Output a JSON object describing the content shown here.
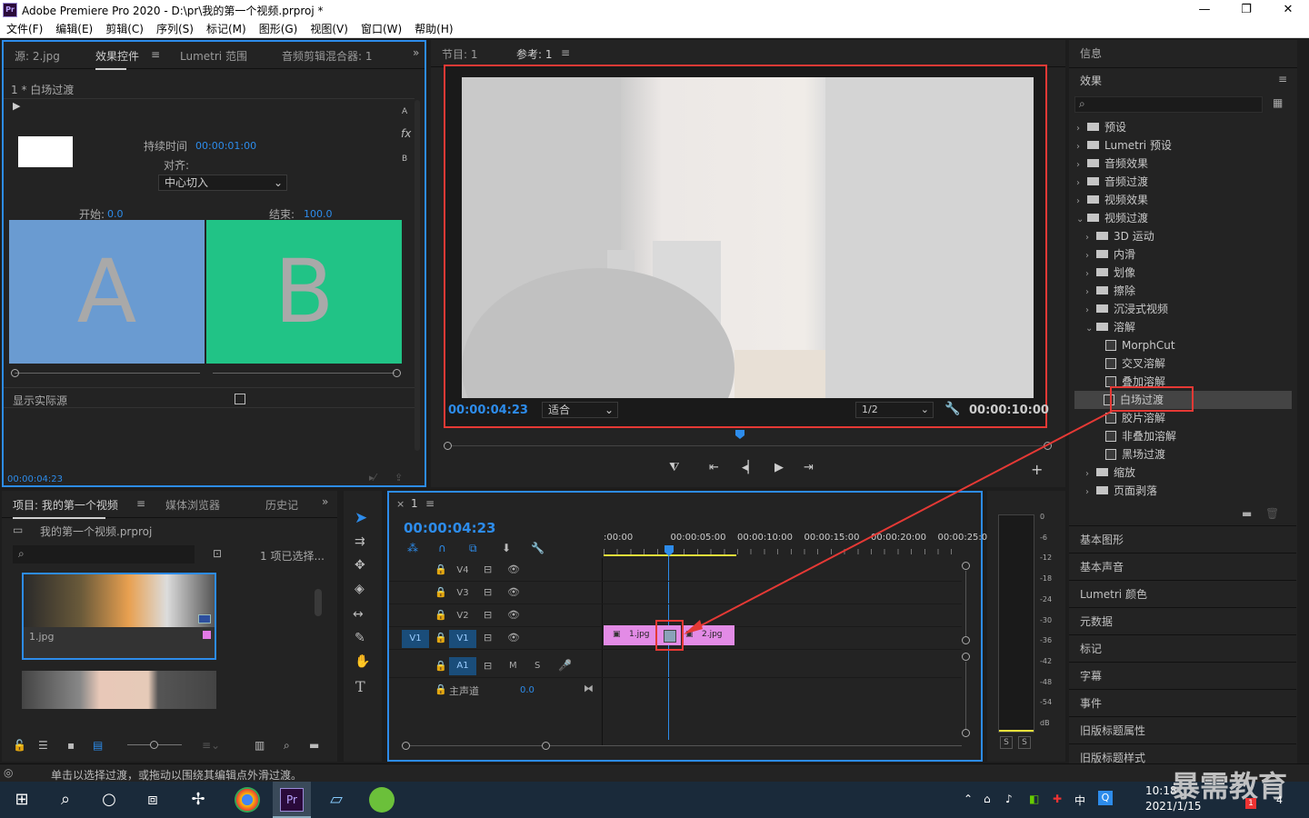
{
  "window": {
    "title": "Adobe Premiere Pro 2020 - D:\\pr\\我的第一个视频.prproj *",
    "logo": "Pr"
  },
  "menu": [
    "文件(F)",
    "编辑(E)",
    "剪辑(C)",
    "序列(S)",
    "标记(M)",
    "图形(G)",
    "视图(V)",
    "窗口(W)",
    "帮助(H)"
  ],
  "source_panel": {
    "tabs": [
      "源: 2.jpg",
      "效果控件",
      "Lumetri 范围",
      "音频剪辑混合器: 1"
    ],
    "clip_label": "1 * 白场过渡",
    "duration_label": "持续时间",
    "duration_value": "00:00:01:00",
    "align_label": "对齐:",
    "align_value": "中心切入",
    "start_label": "开始:",
    "start_value": "0.0",
    "end_label": "结束:",
    "end_value": "100.0",
    "a_letter": "A",
    "b_letter": "B",
    "show_actual_label": "显示实际源",
    "timecode": "00:00:04:23",
    "side_a": "A",
    "side_fx": "fx",
    "side_b": "B",
    "colors": {
      "a": "#6a9bd1",
      "b": "#21c386"
    }
  },
  "program": {
    "tabs": [
      "节目: 1",
      "参考: 1"
    ],
    "timecode": "00:00:04:23",
    "fit": "适合",
    "resolution": "1/2",
    "duration": "00:00:10:00"
  },
  "effects": {
    "info_title": "信息",
    "title": "效果",
    "items": [
      {
        "label": "预设",
        "indent": 0,
        "kind": "folder",
        "caret": "›"
      },
      {
        "label": "Lumetri 预设",
        "indent": 0,
        "kind": "folder",
        "caret": "›"
      },
      {
        "label": "音频效果",
        "indent": 0,
        "kind": "folder",
        "caret": "›"
      },
      {
        "label": "音频过渡",
        "indent": 0,
        "kind": "folder",
        "caret": "›"
      },
      {
        "label": "视频效果",
        "indent": 0,
        "kind": "folder",
        "caret": "›"
      },
      {
        "label": "视频过渡",
        "indent": 0,
        "kind": "folder",
        "caret": "⌄"
      },
      {
        "label": "3D 运动",
        "indent": 1,
        "kind": "folder",
        "caret": "›"
      },
      {
        "label": "内滑",
        "indent": 1,
        "kind": "folder",
        "caret": "›"
      },
      {
        "label": "划像",
        "indent": 1,
        "kind": "folder",
        "caret": "›"
      },
      {
        "label": "擦除",
        "indent": 1,
        "kind": "folder",
        "caret": "›"
      },
      {
        "label": "沉浸式视频",
        "indent": 1,
        "kind": "folder",
        "caret": "›"
      },
      {
        "label": "溶解",
        "indent": 1,
        "kind": "folder",
        "caret": "⌄"
      },
      {
        "label": "MorphCut",
        "indent": 2,
        "kind": "fx",
        "caret": ""
      },
      {
        "label": "交叉溶解",
        "indent": 2,
        "kind": "fx",
        "caret": ""
      },
      {
        "label": "叠加溶解",
        "indent": 2,
        "kind": "fx",
        "caret": ""
      },
      {
        "label": "白场过渡",
        "indent": 2,
        "kind": "fx",
        "caret": "",
        "selected": true
      },
      {
        "label": "胶片溶解",
        "indent": 2,
        "kind": "fx",
        "caret": ""
      },
      {
        "label": "非叠加溶解",
        "indent": 2,
        "kind": "fx",
        "caret": ""
      },
      {
        "label": "黑场过渡",
        "indent": 2,
        "kind": "fx",
        "caret": ""
      },
      {
        "label": "缩放",
        "indent": 1,
        "kind": "folder",
        "caret": "›"
      },
      {
        "label": "页面剥落",
        "indent": 1,
        "kind": "folder",
        "caret": "›"
      }
    ],
    "panels": [
      "基本图形",
      "基本声音",
      "Lumetri 颜色",
      "元数据",
      "标记",
      "字幕",
      "事件",
      "旧版标题属性",
      "旧版标题样式"
    ]
  },
  "project": {
    "tabs": [
      "项目: 我的第一个视频",
      "媒体浏览器",
      "历史记"
    ],
    "file": "我的第一个视频.prproj",
    "selection": "1 项已选择...",
    "clip1": "1.jpg"
  },
  "timeline": {
    "tab": "1",
    "timecode": "00:00:04:23",
    "ruler": [
      ":00:00",
      "00:00:05:00",
      "00:00:10:00",
      "00:00:15:00",
      "00:00:20:00",
      "00:00:25:0("
    ],
    "tracks": [
      "V4",
      "V3",
      "V2",
      "V1"
    ],
    "v1_source": "V1",
    "a1": "A1",
    "m": "M",
    "s": "S",
    "master": "主声道",
    "master_value": "0.0",
    "clip1": "1.jpg",
    "clip2": "2.jpg"
  },
  "meter": {
    "labels": [
      "0",
      "-6",
      "-12",
      "-18",
      "-24",
      "-30",
      "-36",
      "-42",
      "-48",
      "-54",
      "dB"
    ],
    "s1": "S",
    "s2": "S"
  },
  "status": "单击以选择过渡，或拖动以围绕其编辑点外滑过渡。",
  "taskbar": {
    "time": "10:18",
    "date": "2021/1/15",
    "ime": "中",
    "watermark": "暴需教育",
    "badge": "1",
    "notif": "4"
  }
}
